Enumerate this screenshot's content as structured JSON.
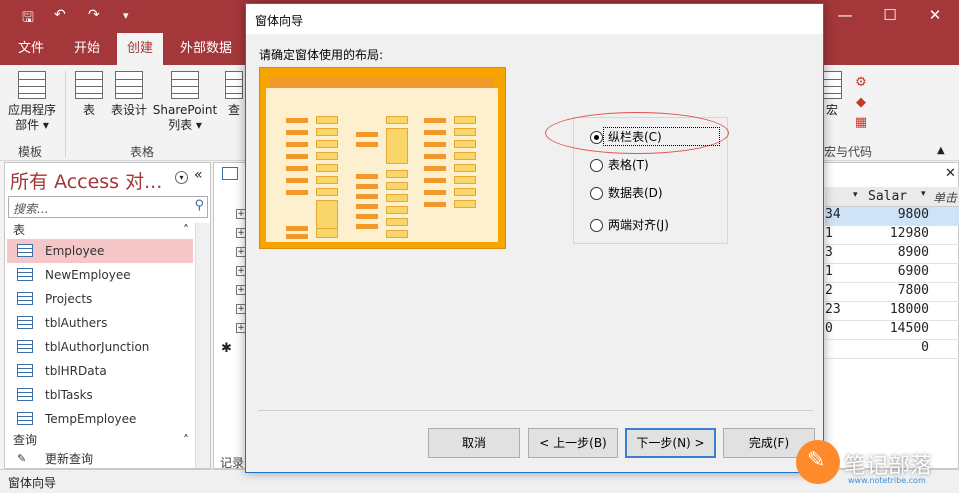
{
  "titlebar": {
    "bg": "#a4373a",
    "qat_save_icon": "save-icon",
    "qat_undo_icon": "undo-icon",
    "qat_redo_icon": "redo-icon",
    "qat_more_icon": "dropdown-icon"
  },
  "tabs": [
    {
      "label": "文件"
    },
    {
      "label": "开始"
    },
    {
      "label": "创建"
    },
    {
      "label": "外部数据"
    }
  ],
  "ribbon": {
    "app_parts": "应用程序\n部件 ▾",
    "table": "表",
    "table_design": "表设计",
    "sharepoint": "SharePoint\n列表 ▾",
    "query_partial": "查",
    "macro_partial": "宏",
    "group_template": "模板",
    "group_tables": "表格",
    "group_macro_code": "宏与代码"
  },
  "navpane": {
    "title": "所有 Access 对...",
    "search_placeholder": "搜索...",
    "section_tables": "表",
    "tables": [
      "Employee",
      "NewEmployee",
      "Projects",
      "tblAuthers",
      "tblAuthorJunction",
      "tblHRData",
      "tblTasks",
      "TempEmployee"
    ],
    "section_queries": "查询",
    "queries": [
      "更新查询"
    ]
  },
  "sheet": {
    "header_salary": "Salar",
    "header_next": "单击",
    "col1": [
      "34",
      "1",
      "3",
      "1",
      "2",
      "23",
      "0",
      ""
    ],
    "salary": [
      "9800",
      "12980",
      "8900",
      "6900",
      "7800",
      "18000",
      "14500",
      "0"
    ],
    "record_label": "记录"
  },
  "statusbar": {
    "text": "窗体向导"
  },
  "dialog": {
    "title": "窗体向导",
    "prompt": "请确定窗体使用的布局:",
    "options": [
      {
        "label": "纵栏表(C)",
        "selected": true
      },
      {
        "label": "表格(T)",
        "selected": false
      },
      {
        "label": "数据表(D)",
        "selected": false
      },
      {
        "label": "两端对齐(J)",
        "selected": false
      }
    ],
    "buttons": {
      "cancel": "取消",
      "back": "< 上一步(B)",
      "next": "下一步(N) >",
      "finish": "完成(F)"
    }
  },
  "watermark": {
    "text": "笔记部落",
    "small": "www.notetribe.com"
  }
}
